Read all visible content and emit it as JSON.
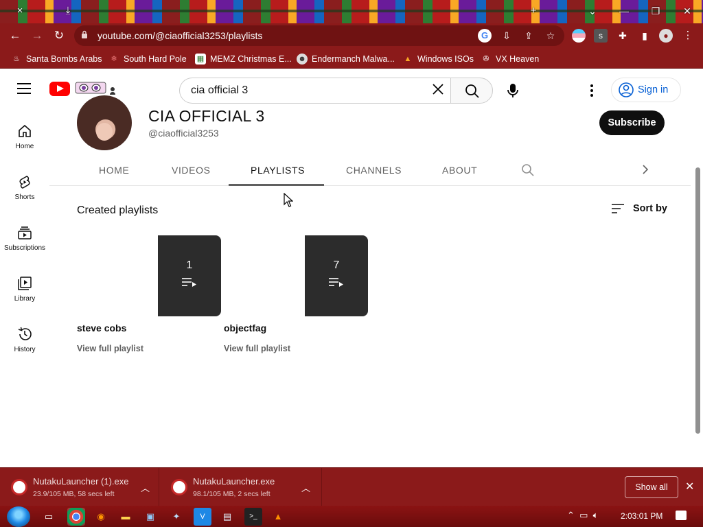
{
  "browser": {
    "tab_close_glyph": "×",
    "new_tab_glyph": "+",
    "url": "youtube.com/@ciaofficial3253/playlists",
    "bookmarks": [
      {
        "label": "Santa Bombs Arabs"
      },
      {
        "label": "South Hard Pole"
      },
      {
        "label": "MEMZ Christmas E..."
      },
      {
        "label": "Endermanch Malwa..."
      },
      {
        "label": "Windows ISOs"
      },
      {
        "label": "VX Heaven"
      }
    ],
    "extension_badge": "s"
  },
  "masthead": {
    "search_value": "cia official 3",
    "signin_label": "Sign in"
  },
  "guide": {
    "items": [
      {
        "label": "Home"
      },
      {
        "label": "Shorts"
      },
      {
        "label": "Subscriptions"
      },
      {
        "label": "Library"
      },
      {
        "label": "History"
      }
    ]
  },
  "channel": {
    "name": "CIA OFFICIAL 3",
    "handle": "@ciaofficial3253",
    "subscribe_label": "Subscribe",
    "tabs": [
      {
        "label": "HOME"
      },
      {
        "label": "VIDEOS"
      },
      {
        "label": "PLAYLISTS"
      },
      {
        "label": "CHANNELS"
      },
      {
        "label": "ABOUT"
      }
    ],
    "active_tab": "PLAYLISTS"
  },
  "playlists": {
    "section_title": "Created playlists",
    "sort_label": "Sort by",
    "items": [
      {
        "title": "steve cobs",
        "count": "1",
        "link": "View full playlist"
      },
      {
        "title": "objectfag",
        "count": "7",
        "link": "View full playlist"
      }
    ]
  },
  "downloads": {
    "items": [
      {
        "name": "NutakuLauncher (1).exe",
        "status": "23.9/105 MB, 58 secs left"
      },
      {
        "name": "NutakuLauncher.exe",
        "status": "98.1/105 MB, 2 secs left"
      }
    ],
    "show_all_label": "Show all"
  },
  "taskbar": {
    "clock": "2:03:01 PM"
  },
  "colors": {
    "chrome_theme": "#8b1a1a",
    "youtube_red": "#ff0000",
    "link_blue": "#065fd4"
  }
}
